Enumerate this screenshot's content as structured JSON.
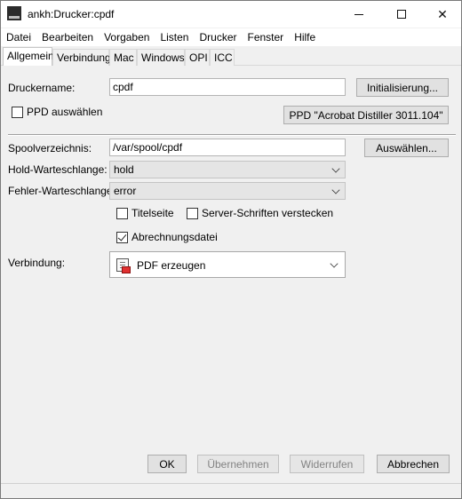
{
  "window": {
    "title": "ankh:Drucker:cpdf",
    "minimize_glyph": "—",
    "close_glyph": "✕"
  },
  "menu": [
    "Datei",
    "Bearbeiten",
    "Vorgaben",
    "Listen",
    "Drucker",
    "Fenster",
    "Hilfe"
  ],
  "tabs": [
    "Allgemein",
    "Verbindung",
    "Mac",
    "Windows",
    "OPI",
    "ICC"
  ],
  "active_tab": "Allgemein",
  "form": {
    "printer_name_label": "Druckername:",
    "printer_name_value": "cpdf",
    "init_button": "Initialisierung...",
    "ppd_select_label": "PPD auswählen",
    "ppd_select_checked": false,
    "ppd_button": "PPD \"Acrobat Distiller 3011.104\"",
    "spool_label": "Spoolverzeichnis:",
    "spool_value": "/var/spool/cpdf",
    "choose_button": "Auswählen...",
    "hold_label": "Hold-Warteschlange:",
    "hold_value": "hold",
    "error_label": "Fehler-Warteschlange:",
    "error_value": "error",
    "title_page_label": "Titelseite",
    "title_page_checked": false,
    "hide_fonts_label": "Server-Schriften verstecken",
    "hide_fonts_checked": false,
    "accounting_label": "Abrechnungsdatei",
    "accounting_checked": true,
    "connection_label": "Verbindung:",
    "connection_value": "PDF erzeugen",
    "connection_icon": "pdf-document-icon"
  },
  "buttons": {
    "ok": "OK",
    "apply": "Übernehmen",
    "revert": "Widerrufen",
    "cancel": "Abbrechen"
  }
}
